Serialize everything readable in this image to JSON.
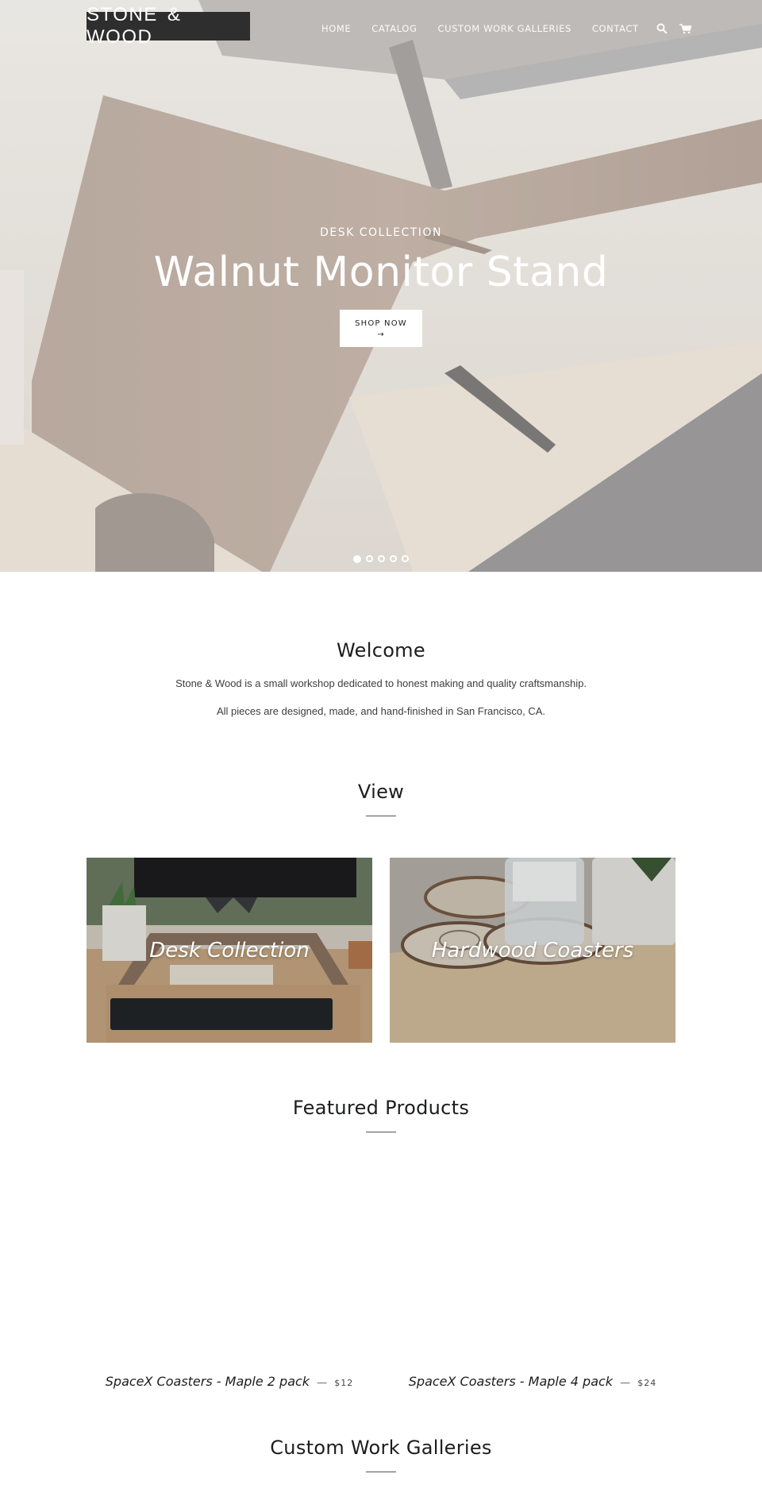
{
  "header": {
    "logo": "STONE & WOOD",
    "nav": [
      {
        "label": "HOME"
      },
      {
        "label": "CATALOG"
      },
      {
        "label": "CUSTOM WORK GALLERIES"
      },
      {
        "label": "CONTACT"
      }
    ],
    "icons": {
      "search": "search-icon",
      "cart": "cart-icon"
    }
  },
  "hero": {
    "kicker": "DESK COLLECTION",
    "title": "Walnut Monitor Stand",
    "button_label": "SHOP NOW",
    "button_arrow": "→",
    "slides_total": 5,
    "active_slide": 1
  },
  "welcome": {
    "title": "Welcome",
    "paragraphs": [
      "Stone & Wood is a small workshop dedicated to honest making and quality craftsmanship.",
      "All pieces are designed, made, and hand-finished in San Francisco, CA."
    ]
  },
  "view": {
    "title": "View",
    "collections": [
      {
        "label": "Desk Collection"
      },
      {
        "label": "Hardwood Coasters"
      }
    ]
  },
  "featured": {
    "title": "Featured Products",
    "products": [
      {
        "title": "SpaceX Coasters - Maple 2 pack",
        "separator": "—",
        "price": "$12"
      },
      {
        "title": "SpaceX Coasters - Maple 4 pack",
        "separator": "—",
        "price": "$24"
      }
    ]
  },
  "galleries": {
    "title": "Custom Work Galleries"
  },
  "colors": {
    "logo_bg": "#2e2e2e",
    "text": "#1c1d1d",
    "white": "#ffffff"
  }
}
